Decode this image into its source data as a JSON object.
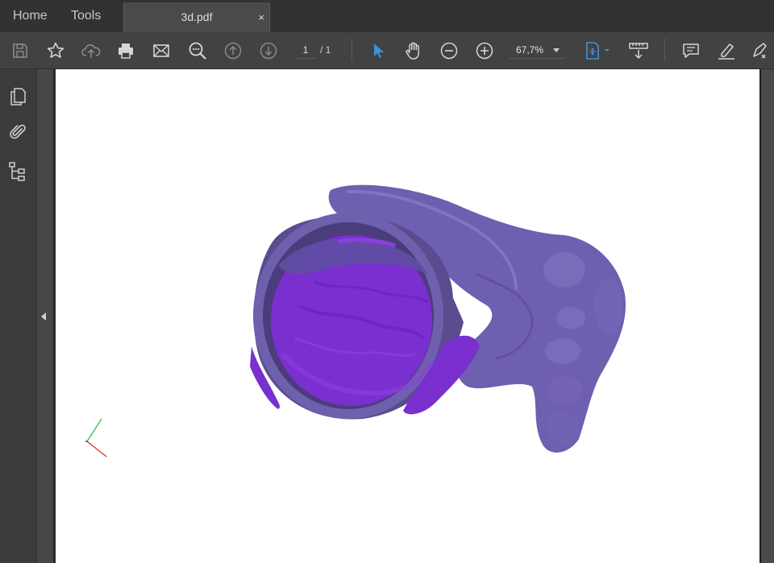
{
  "tabs": {
    "home": "Home",
    "tools": "Tools"
  },
  "document_tab": {
    "title": "3d.pdf",
    "close": "×"
  },
  "toolbar": {
    "page_current": "1",
    "page_total": "/ 1",
    "zoom": "67,7%",
    "icons": [
      "save-icon",
      "bookmark-star-icon",
      "upload-cloud-icon",
      "print-icon",
      "email-icon",
      "zoom-search-icon",
      "previous-page-icon",
      "next-page-icon",
      "select-cursor-icon",
      "hand-tool-icon",
      "zoom-out-icon",
      "zoom-in-icon",
      "fit-page-icon",
      "scroll-mode-icon",
      "comment-icon",
      "highlight-pen-icon",
      "sign-icon"
    ]
  },
  "sidebar": {
    "icons": [
      "page-thumbnails-icon",
      "attachments-icon",
      "model-tree-icon"
    ]
  },
  "colors": {
    "accent": "#3d8fe0",
    "model_outer": "#6f5fb0",
    "model_inner": "#7b2fd0"
  }
}
